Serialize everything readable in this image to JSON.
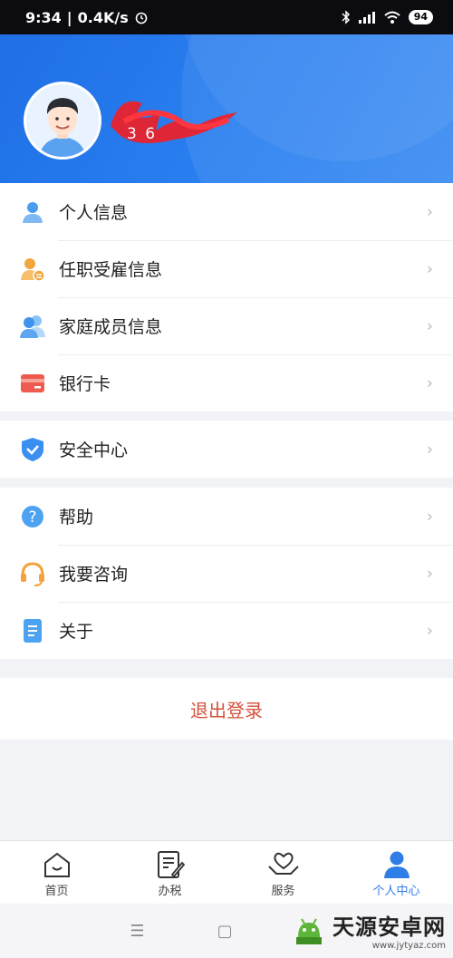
{
  "status_bar": {
    "time": "9:34",
    "speed": "0.4K/s",
    "battery": "94"
  },
  "profile": {
    "user_id": "3 6"
  },
  "menu_groups": [
    [
      {
        "label": "个人信息",
        "icon": "person-icon"
      },
      {
        "label": "任职受雇信息",
        "icon": "employment-icon"
      },
      {
        "label": "家庭成员信息",
        "icon": "family-icon"
      },
      {
        "label": "银行卡",
        "icon": "bank-card-icon"
      }
    ],
    [
      {
        "label": "安全中心",
        "icon": "shield-icon"
      }
    ],
    [
      {
        "label": "帮助",
        "icon": "question-icon"
      },
      {
        "label": "我要咨询",
        "icon": "headset-icon"
      },
      {
        "label": "关于",
        "icon": "document-icon"
      }
    ]
  ],
  "logout": {
    "label": "退出登录"
  },
  "tabs": [
    {
      "label": "首页",
      "icon": "home-icon"
    },
    {
      "label": "办税",
      "icon": "tax-edit-icon"
    },
    {
      "label": "服务",
      "icon": "heart-hand-icon"
    },
    {
      "label": "个人中心",
      "icon": "person-center-icon"
    }
  ],
  "watermark": {
    "title": "天源安卓网",
    "url": "www.jytyaz.com"
  },
  "colors": {
    "header_blue": "#2a80f0",
    "active_tab": "#2f7de6",
    "logout_red": "#d5503c"
  }
}
